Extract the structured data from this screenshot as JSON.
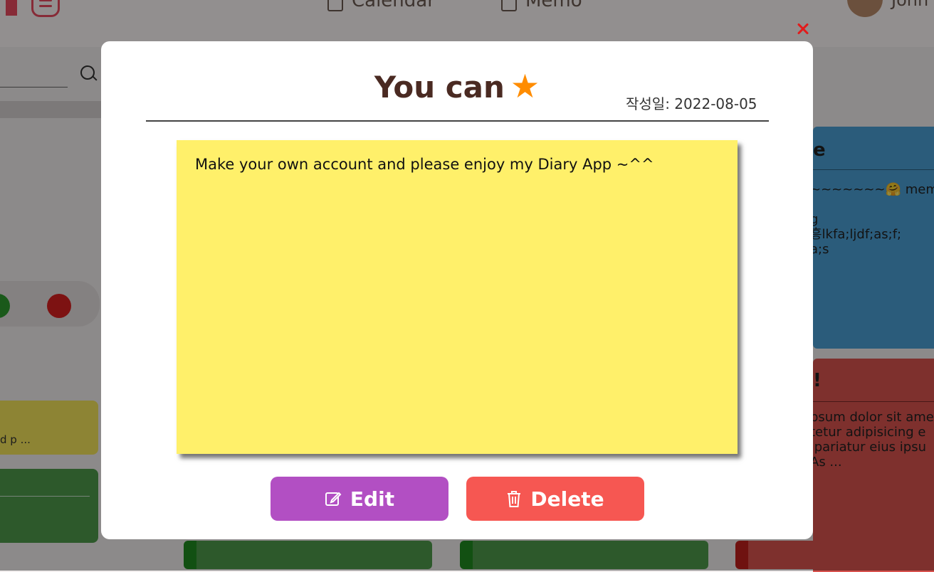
{
  "nav": {
    "calendar_label": "Calendar",
    "memo_label": "Memo",
    "user_name": "John",
    "calendar_icon": "calendar-icon",
    "memo_icon": "notebook-icon"
  },
  "background": {
    "left_card_snippet": "d p ...",
    "right_cards": [
      {
        "title": "e",
        "lines": "~~~~~~~🤗 memo\n\ng\n흥lkfa;ljdf;as;f;\na;s",
        "color": "#4a9fd4"
      },
      {
        "title": "!",
        "lines": "psum dolor sit ame\ntetur adipisicing e\n pariatur eius ipsu\nAs ...",
        "color": "#d9534f"
      }
    ],
    "dot_colors": [
      "#2e9a2e",
      "#d82020"
    ]
  },
  "modal": {
    "title": "You can",
    "title_icon": "star-icon",
    "date_text": "작성일: 2022-08-05",
    "note_text": "Make your own account and please enjoy my Diary App ~^^",
    "note_color": "#fff06a",
    "edit_label": "Edit",
    "delete_label": "Delete",
    "edit_color": "#b24fc3",
    "delete_color": "#f65752",
    "close_icon": "close-icon"
  }
}
